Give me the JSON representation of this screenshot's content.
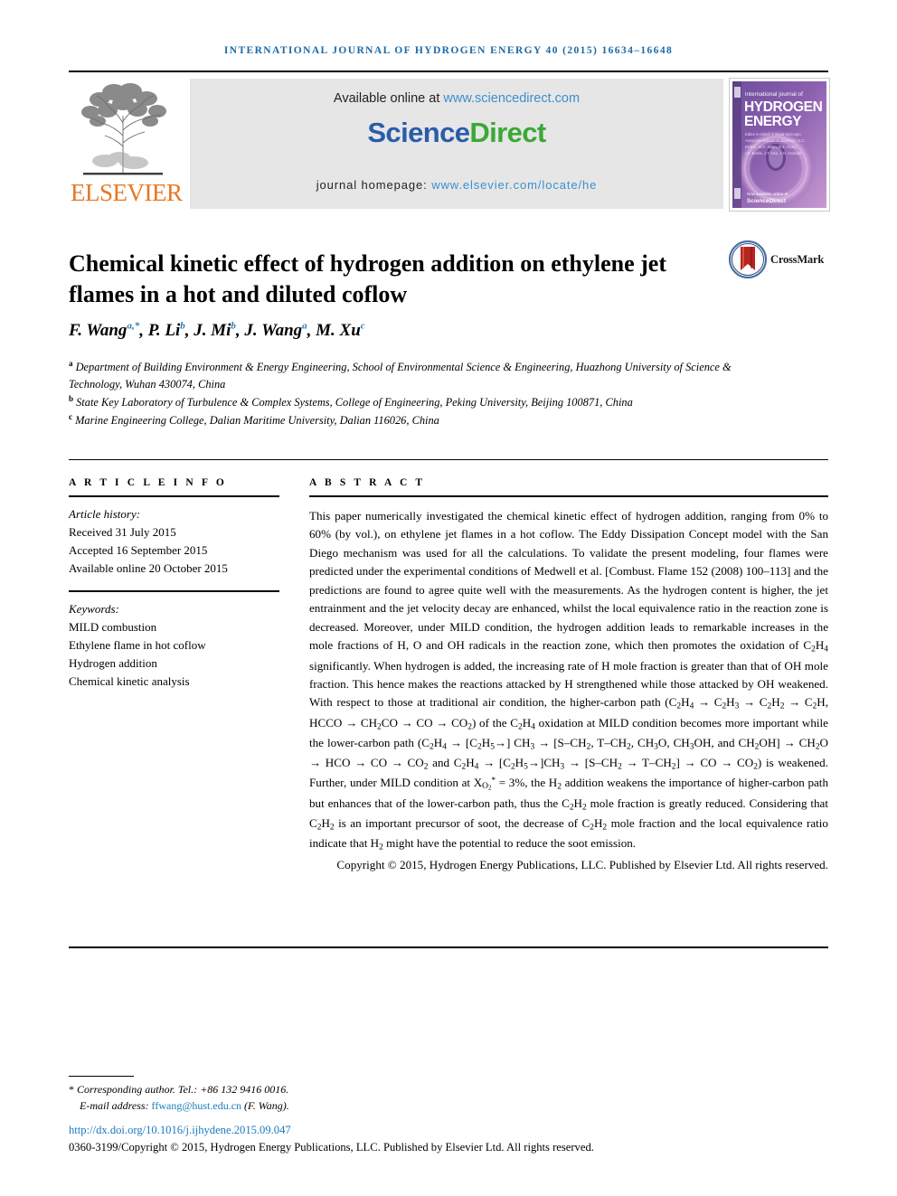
{
  "running_head": "International Journal of Hydrogen Energy 40 (2015) 16634–16648",
  "masthead": {
    "publisher_name": "ELSEVIER",
    "publisher_logo_alt": "elsevier-tree-logo",
    "available_online_label": "Available online at",
    "available_online_url": "www.sciencedirect.com",
    "sciencedirect_part1": "Science",
    "sciencedirect_part2": "Direct",
    "journal_homepage_label": "journal homepage:",
    "journal_homepage_url": "www.elsevier.com/locate/he",
    "cover": {
      "line1": "international journal of",
      "line2": "HYDROGEN",
      "line3": "ENERGY",
      "editors": "Editor-in-Chief: T. Nejat Veziroglu",
      "footer_brand": "ScienceDirect"
    }
  },
  "article": {
    "title": "Chemical kinetic effect of hydrogen addition on ethylene jet flames in a hot and diluted coflow",
    "crossmark_label": "CrossMark",
    "authors": [
      {
        "name": "F. Wang",
        "marks": "a,*"
      },
      {
        "name": "P. Li",
        "marks": "b"
      },
      {
        "name": "J. Mi",
        "marks": "b"
      },
      {
        "name": "J. Wang",
        "marks": "a"
      },
      {
        "name": "M. Xu",
        "marks": "c"
      }
    ],
    "affiliations": [
      {
        "mark": "a",
        "text": "Department of Building Environment & Energy Engineering, School of Environmental Science & Engineering, Huazhong University of Science & Technology, Wuhan 430074, China"
      },
      {
        "mark": "b",
        "text": "State Key Laboratory of Turbulence & Complex Systems, College of Engineering, Peking University, Beijing 100871, China"
      },
      {
        "mark": "c",
        "text": "Marine Engineering College, Dalian Maritime University, Dalian 116026, China"
      }
    ]
  },
  "article_info": {
    "heading": "A R T I C L E  I N F O",
    "history_label": "Article history:",
    "history": [
      "Received 31 July 2015",
      "Accepted 16 September 2015",
      "Available online 20 October 2015"
    ],
    "keywords_label": "Keywords:",
    "keywords": [
      "MILD combustion",
      "Ethylene flame in hot coflow",
      "Hydrogen addition",
      "Chemical kinetic analysis"
    ]
  },
  "abstract": {
    "heading": "A B S T R A C T",
    "body_html": "This paper numerically investigated the chemical kinetic effect of hydrogen addition, ranging from 0% to 60% (by vol.), on ethylene jet flames in a hot coflow. The Eddy Dissipation Concept model with the San Diego mechanism was used for all the calculations. To validate the present modeling, four flames were predicted under the experimental conditions of Medwell et al. [Combust. Flame 152 (2008) 100&ndash;113] and the predictions are found to agree quite well with the measurements. As the hydrogen content is higher, the jet entrainment and the jet velocity decay are enhanced, whilst the local equivalence ratio in the reaction zone is decreased. Moreover, under MILD condition, the hydrogen addition leads to remarkable increases in the mole fractions of H, O and OH radicals in the reaction zone, which then promotes the oxidation of C<sub>2</sub>H<sub>4</sub> significantly. When hydrogen is added, the increasing rate of H mole fraction is greater than that of OH mole fraction. This hence makes the reactions attacked by H strengthened while those attacked by OH weakened. With respect to those at traditional air condition, the higher-carbon path (C<sub>2</sub>H<sub>4</sub> &rarr; C<sub>2</sub>H<sub>3</sub> &rarr; C<sub>2</sub>H<sub>2</sub> &rarr; C<sub>2</sub>H, HCCO &rarr; CH<sub>2</sub>CO &rarr; CO &rarr; CO<sub>2</sub>) of the C<sub>2</sub>H<sub>4</sub> oxidation at MILD condition becomes more important while the lower-carbon path (C<sub>2</sub>H<sub>4</sub> &rarr; [C<sub>2</sub>H<sub>5</sub>&rarr;] CH<sub>3</sub> &rarr; [S&ndash;CH<sub>2</sub>, T&ndash;CH<sub>2</sub>, CH<sub>3</sub>O, CH<sub>3</sub>OH, and CH<sub>2</sub>OH] &rarr; CH<sub>2</sub>O &rarr; HCO &rarr; CO &rarr; CO<sub>2</sub> and C<sub>2</sub>H<sub>4</sub> &rarr; [C<sub>2</sub>H<sub>5</sub>&rarr;]CH<sub>3</sub> &rarr; [S&ndash;CH<sub>2</sub> &rarr; T&ndash;CH<sub>2</sub>] &rarr; CO &rarr; CO<sub>2</sub>) is weakened. Further, under MILD condition at X<sub>O<sub>2</sub></sub><sup class=\"supn\">*</sup> = 3%, the H<sub>2</sub> addition weakens the importance of higher-carbon path but enhances that of the lower-carbon path, thus the C<sub>2</sub>H<sub>2</sub> mole fraction is greatly reduced. Considering that C<sub>2</sub>H<sub>2</sub> is an important precursor of soot, the decrease of C<sub>2</sub>H<sub>2</sub> mole fraction and the local equivalence ratio indicate that H<sub>2</sub> might have the potential to reduce the soot emission.",
    "copyright": "Copyright © 2015, Hydrogen Energy Publications, LLC. Published by Elsevier Ltd. All rights reserved."
  },
  "footer": {
    "corresponding_star": "*",
    "corresponding_text": "Corresponding author. Tel.: +86 132 9416 0016.",
    "email_label": "E-mail address:",
    "email": "ffwang@hust.edu.cn",
    "email_owner": "(F. Wang).",
    "doi_url": "http://dx.doi.org/10.1016/j.ijhydene.2015.09.047",
    "issn_line": "0360-3199/Copyright © 2015, Hydrogen Energy Publications, LLC. Published by Elsevier Ltd. All rights reserved."
  },
  "colors": {
    "running_head_blue": "#1a6aa8",
    "link_blue": "#3b8fd0",
    "elsevier_orange": "#e87722",
    "sciencedirect_blue": "#2a5caa",
    "sciencedirect_green": "#3aa935",
    "doi_blue": "#1a7bbd"
  }
}
